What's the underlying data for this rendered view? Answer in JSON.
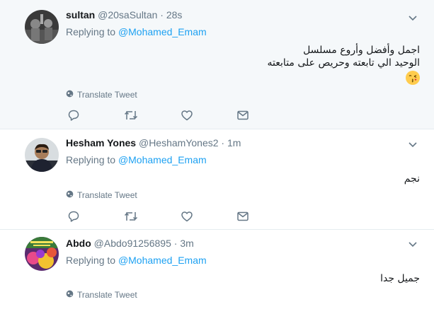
{
  "icons": {
    "globe": "globe-icon",
    "reply": "reply-icon",
    "retweet": "retweet-icon",
    "like": "heart-icon",
    "dm": "envelope-icon",
    "caret": "chevron-down-icon",
    "emoji": "kissing-face-emoji"
  },
  "colors": {
    "link": "#1da1f2",
    "muted": "#657786",
    "highlight_bg": "#f5f8fa",
    "border": "#e6ecf0"
  },
  "tweets": [
    {
      "name": "sultan",
      "handle": "@20saSultan",
      "separator": "·",
      "time": "28s",
      "replying_prefix": "Replying to",
      "replying_to": "@Mohamed_Emam",
      "text_lines": [
        "اجمل وأفضل وأروع مسلسل",
        "الوحيد الي تابعته وحريص على متابعته"
      ],
      "translate_label": "Translate Tweet"
    },
    {
      "name": "Hesham Yones",
      "handle": "@HeshamYones2",
      "separator": "·",
      "time": "1m",
      "replying_prefix": "Replying to",
      "replying_to": "@Mohamed_Emam",
      "text_lines": [
        "نجم"
      ],
      "translate_label": "Translate Tweet"
    },
    {
      "name": "Abdo",
      "handle": "@Abdo91256895",
      "separator": "·",
      "time": "3m",
      "replying_prefix": "Replying to",
      "replying_to": "@Mohamed_Emam",
      "text_lines": [
        "جميل جدا"
      ],
      "translate_label": "Translate Tweet"
    }
  ]
}
